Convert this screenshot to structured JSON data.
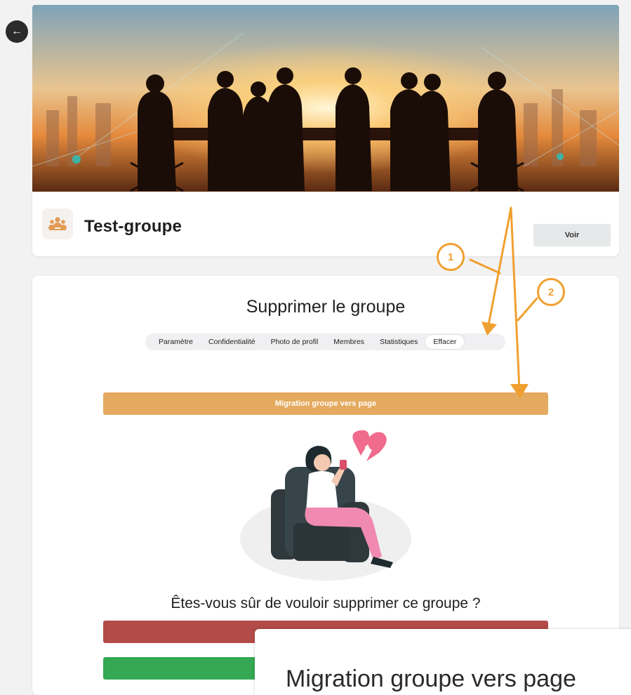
{
  "group": {
    "name": "Test-groupe",
    "view_label": "Voir"
  },
  "section": {
    "title": "Supprimer le groupe"
  },
  "tabs": [
    {
      "label": "Paramètre",
      "active": false
    },
    {
      "label": "Confidentialité",
      "active": false
    },
    {
      "label": "Photo de profil",
      "active": false
    },
    {
      "label": "Membres",
      "active": false
    },
    {
      "label": "Statistiques",
      "active": false
    },
    {
      "label": "Effacer",
      "active": true
    }
  ],
  "actions": {
    "migration_label": "Migration groupe vers page",
    "delete_label": "",
    "cancel_label": ""
  },
  "confirm": {
    "question": "Êtes-vous sûr de vouloir supprimer ce groupe ?"
  },
  "annotations": {
    "marker_1": "1",
    "marker_2": "2",
    "zoom_label": "Migration groupe vers page"
  },
  "colors": {
    "accent_orange": "#e4aa60",
    "annotation_orange": "#f0a030",
    "danger_red": "#b34b48",
    "success_green": "#34a853"
  }
}
